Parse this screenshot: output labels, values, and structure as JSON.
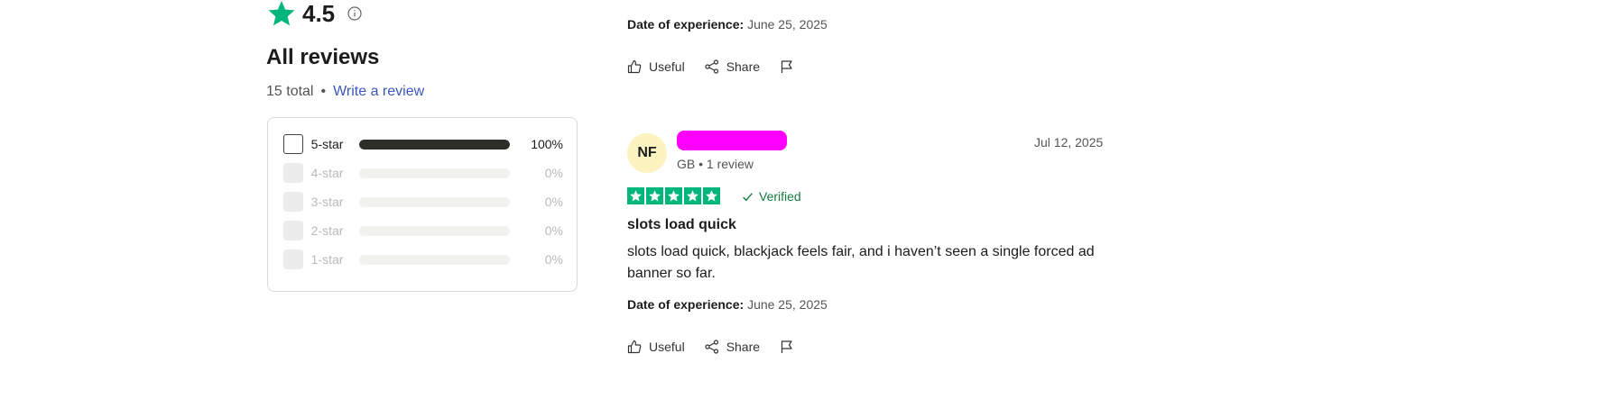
{
  "summary": {
    "rating": "4.5",
    "heading": "All reviews",
    "total": "15 total",
    "separator": "•",
    "write_review": "Write a review"
  },
  "filters": [
    {
      "label": "5-star",
      "percent": "100%",
      "fraction": 1.0,
      "active": true
    },
    {
      "label": "4-star",
      "percent": "0%",
      "fraction": 0,
      "active": false
    },
    {
      "label": "3-star",
      "percent": "0%",
      "fraction": 0,
      "active": false
    },
    {
      "label": "2-star",
      "percent": "0%",
      "fraction": 0,
      "active": false
    },
    {
      "label": "1-star",
      "percent": "0%",
      "fraction": 0,
      "active": false
    }
  ],
  "previous_review": {
    "doe_label": "Date of experience:",
    "doe_value": "June 25, 2025",
    "useful": "Useful",
    "share": "Share"
  },
  "review": {
    "initials": "NF",
    "meta": "GB • 1 review",
    "date": "Jul 12, 2025",
    "stars": 5,
    "verified": "Verified",
    "title": "slots load quick",
    "body": "slots load quick, blackjack feels fair, and i haven’t seen a single forced ad banner so far.",
    "doe_label": "Date of experience:",
    "doe_value": "June 25, 2025",
    "useful": "Useful",
    "share": "Share"
  },
  "colors": {
    "trustpilot_green": "#00b67a",
    "link_blue": "#3c57bc",
    "avatar_bg": "#fcf3c0",
    "redaction": "#ff00ff"
  },
  "icons": [
    "star-icon",
    "info-icon",
    "thumbs-up-icon",
    "share-icon",
    "flag-icon",
    "check-icon"
  ]
}
